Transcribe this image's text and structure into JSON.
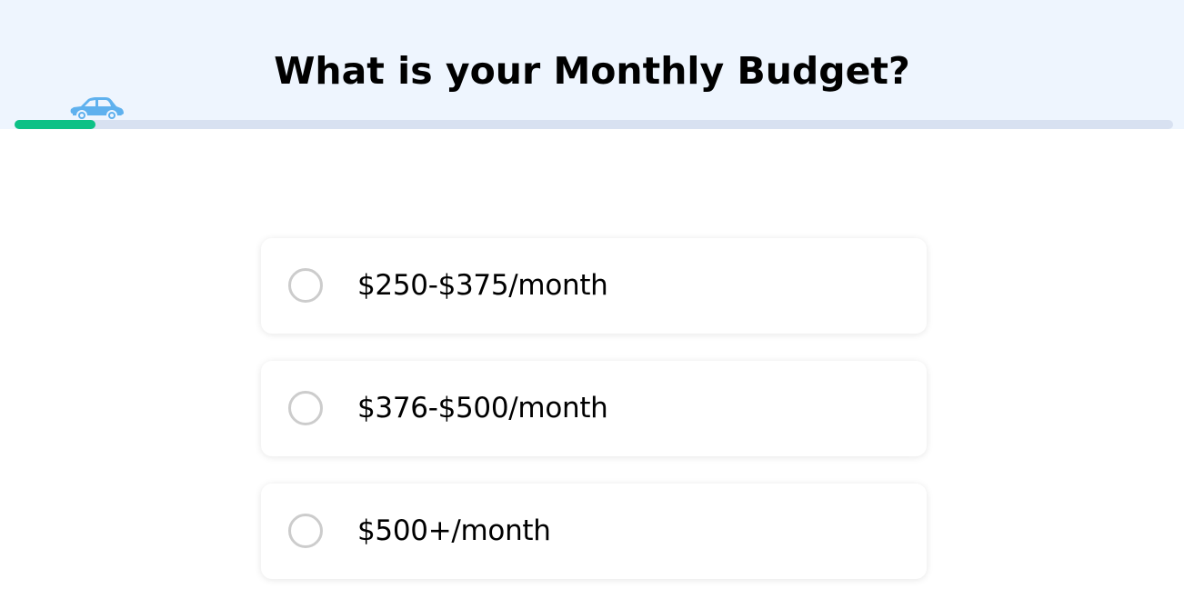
{
  "header": {
    "title": "What is your Monthly Budget?",
    "progress_fraction": 0.07,
    "progress_icon": "car-icon",
    "colors": {
      "background": "#eef5fe",
      "track": "#d8e1f1",
      "fill": "#0cc186",
      "car": "#5fb1ee"
    }
  },
  "options": [
    {
      "label": "$250-$375/month",
      "selected": false
    },
    {
      "label": "$376-$500/month",
      "selected": false
    },
    {
      "label": "$500+/month",
      "selected": false
    }
  ]
}
